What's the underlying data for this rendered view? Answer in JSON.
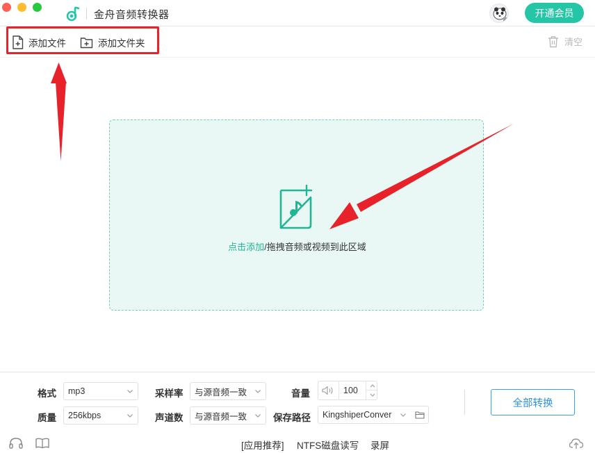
{
  "window": {
    "title": "金舟音频转换器",
    "vip_button": "开通会员"
  },
  "toolbar": {
    "add_file": "添加文件",
    "add_folder": "添加文件夹",
    "clear": "清空"
  },
  "dropzone": {
    "link_text": "点击添加",
    "text": "/拖拽音频或视频到此区域"
  },
  "settings": {
    "format_label": "格式",
    "format_value": "mp3",
    "quality_label": "质量",
    "quality_value": "256kbps",
    "samplerate_label": "采样率",
    "samplerate_value": "与源音频一致",
    "channels_label": "声道数",
    "channels_value": "与源音频一致",
    "volume_label": "音量",
    "volume_value": "100",
    "savepath_label": "保存路径",
    "savepath_value": "KingshiperConver",
    "convert_all": "全部转换"
  },
  "footer": {
    "recommend": "[应用推荐]",
    "ntfs": "NTFS磁盘读写",
    "record": "录屏"
  },
  "colors": {
    "accent": "#24c6a5",
    "dropzone_bg": "#e9f8f5",
    "link": "#22b594",
    "convert_border": "#3aa0e6",
    "annotation_red": "#e8222a"
  },
  "icons": [
    "music-note-logo-icon",
    "avatar-icon",
    "add-file-icon",
    "add-folder-icon",
    "trash-icon",
    "music-file-add-icon",
    "chevron-down-icon",
    "speaker-icon",
    "folder-icon",
    "headset-icon",
    "book-icon",
    "cloud-upload-icon"
  ]
}
